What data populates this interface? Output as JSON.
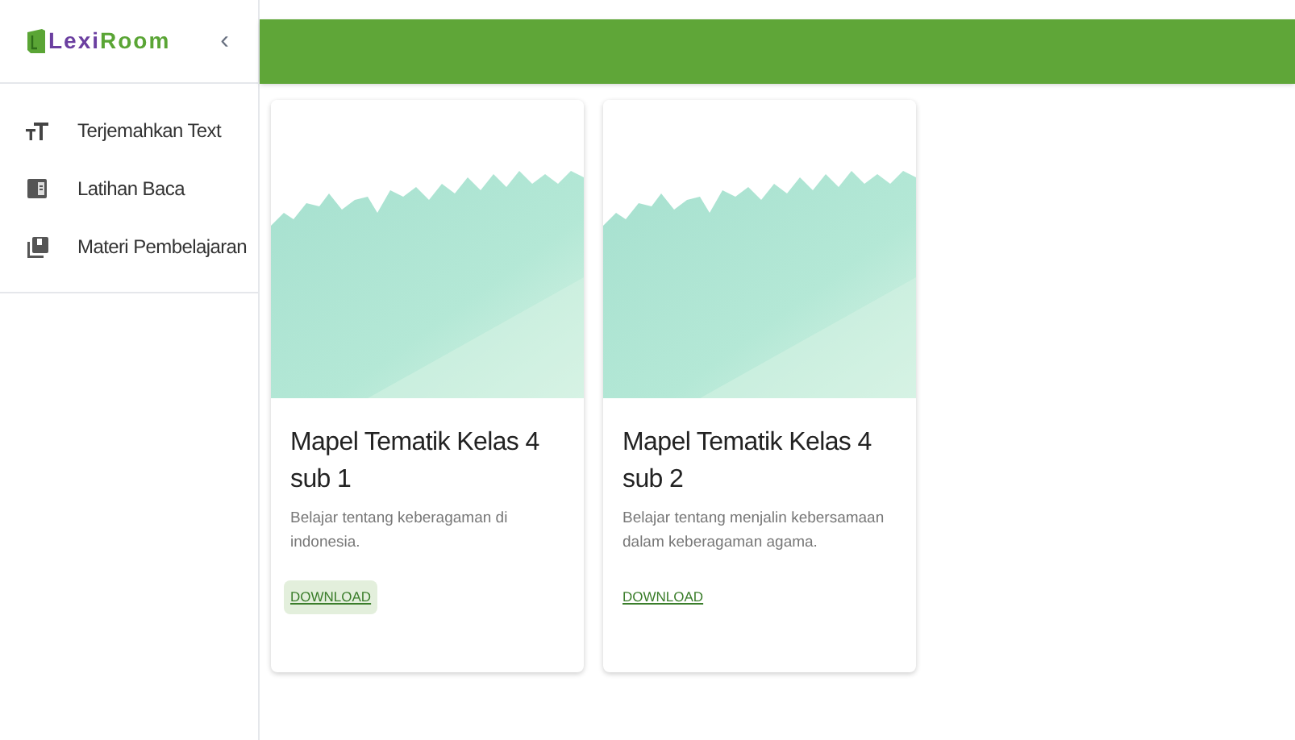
{
  "sidebar": {
    "logo": {
      "prefix": "Lexi",
      "suffix": "Room"
    },
    "collapse_button": "‹",
    "items": [
      {
        "kind": "text",
        "label": "Terjemahkan Text"
      },
      {
        "kind": "read",
        "label": "Latihan Baca"
      },
      {
        "kind": "library",
        "label": "Materi Pembelajaran"
      }
    ]
  },
  "cards": [
    {
      "kind": "picture",
      "title": "Mapel Tematik Kelas 4 sub 1",
      "description": "Belajar tentang keberagaman di indonesia.",
      "action": "DOWNLOAD",
      "highlighted": true
    },
    {
      "kind": "picture",
      "title": "Mapel Tematik Kelas 4 sub 2",
      "description": "Belajar tentang menjalin kebersamaan dalam keberagaman agama.",
      "action": "DOWNLOAD",
      "highlighted": false
    }
  ]
}
